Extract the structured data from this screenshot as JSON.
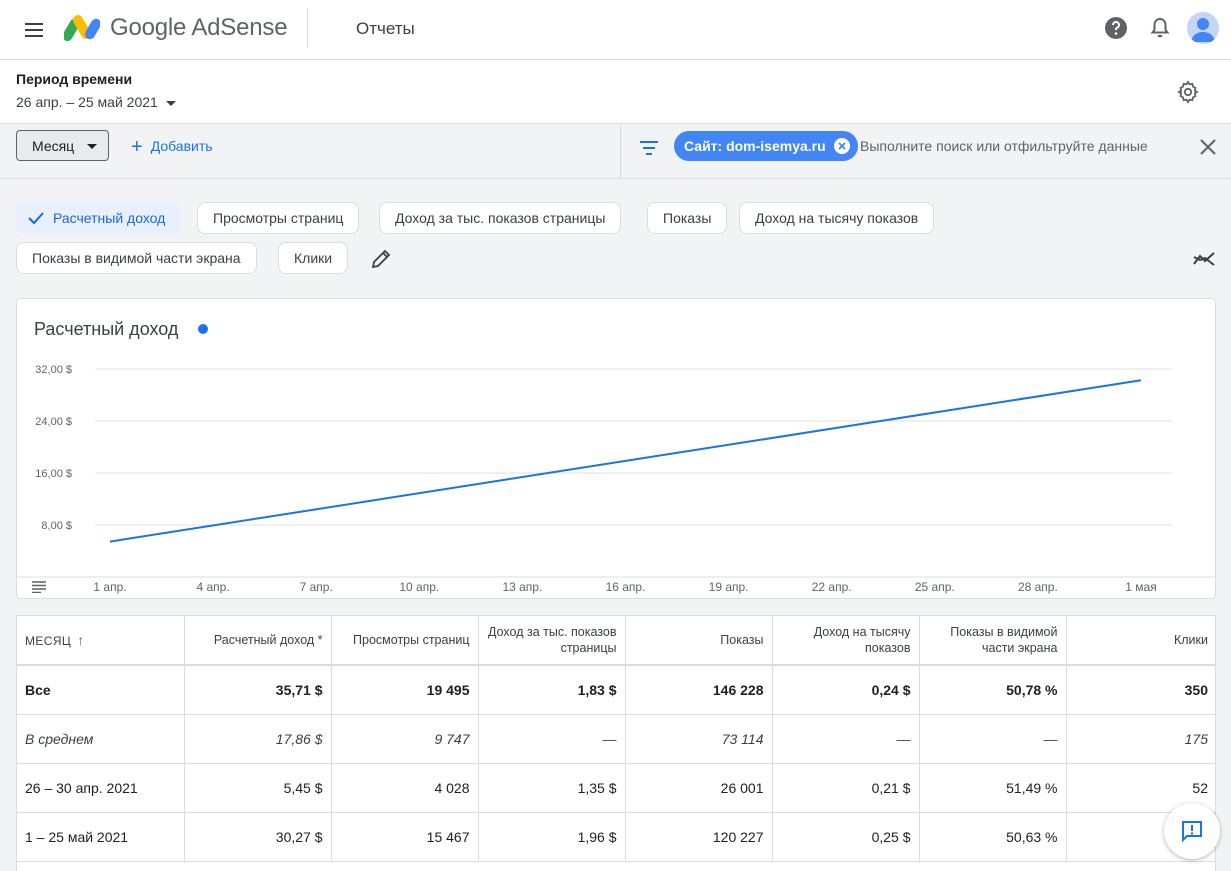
{
  "header": {
    "brand": "Google AdSense",
    "page_title": "Отчеты"
  },
  "period": {
    "label": "Период времени",
    "value": "26 апр. – 25 май 2021"
  },
  "toolbar": {
    "dimension": "Месяц",
    "add_label": "Добавить",
    "filter_chip": "Сайт: dom-isemya.ru",
    "search_placeholder": "Выполните поиск или отфильтруйте данные"
  },
  "metrics": [
    {
      "label": "Расчетный доход",
      "active": true
    },
    {
      "label": "Просмотры страниц",
      "active": false
    },
    {
      "label": "Доход за тыс. показов страницы",
      "active": false
    },
    {
      "label": "Показы",
      "active": false
    },
    {
      "label": "Доход на тысячу показов",
      "active": false
    },
    {
      "label": "Показы в видимой части экрана",
      "active": false
    },
    {
      "label": "Клики",
      "active": false
    }
  ],
  "colors": {
    "accent": "#1a73e8",
    "chip_blue": "#4285f4",
    "active_chip_bg": "#e8f0fe"
  },
  "chart_data": {
    "type": "line",
    "title": "Расчетный доход",
    "x": [
      "1 апр.",
      "4 апр.",
      "7 апр.",
      "10 апр.",
      "13 апр.",
      "16 апр.",
      "19 апр.",
      "22 апр.",
      "25 апр.",
      "28 апр.",
      "1 мая"
    ],
    "y_ticks": [
      "32,00 $",
      "24,00 $",
      "16,00 $",
      "8,00 $"
    ],
    "series": [
      {
        "x": [
          "1 апр.",
          "1 мая"
        ],
        "values": [
          5.45,
          30.27
        ]
      }
    ],
    "ylim": [
      0,
      32
    ],
    "grid": true
  },
  "table": {
    "headers": [
      "МЕСЯЦ",
      "Расчетный доход *",
      "Просмотры страниц",
      "Доход за тыс. показов страницы",
      "Показы",
      "Доход на тысячу показов",
      "Показы в видимой части экрана",
      "Клики"
    ],
    "rows": [
      {
        "type": "total",
        "cells": [
          "Все",
          "35,71 $",
          "19 495",
          "1,83 $",
          "146 228",
          "0,24 $",
          "50,78 %",
          "350"
        ]
      },
      {
        "type": "avg",
        "cells": [
          "В среднем",
          "17,86 $",
          "9 747",
          "—",
          "73 114",
          "—",
          "—",
          "175"
        ]
      },
      {
        "type": "row",
        "cells": [
          "26 – 30 апр. 2021",
          "5,45 $",
          "4 028",
          "1,35 $",
          "26 001",
          "0,21 $",
          "51,49 %",
          "52"
        ]
      },
      {
        "type": "row",
        "cells": [
          "1 – 25 май 2021",
          "30,27 $",
          "15 467",
          "1,96 $",
          "120 227",
          "0,25 $",
          "50,63 %",
          ""
        ]
      }
    ]
  }
}
